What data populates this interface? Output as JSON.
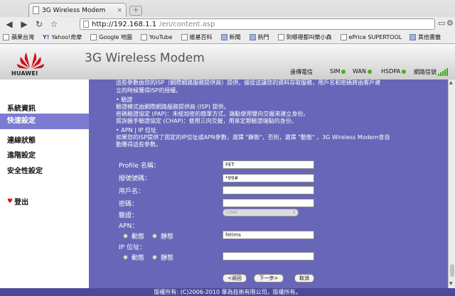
{
  "browser": {
    "tab_title": "3G Wireless Modem",
    "tab_close": "×",
    "new_tab": "+",
    "url_host": "http://192.168.1.1",
    "url_path": "/en/content.asp",
    "bookmarks": [
      {
        "label": "蘋果台灣",
        "kind": "page"
      },
      {
        "label": "Yahoo!奇摩",
        "kind": "yahoo"
      },
      {
        "label": "Google 地圖",
        "kind": "page"
      },
      {
        "label": "YouTube",
        "kind": "page"
      },
      {
        "label": "維基百科",
        "kind": "page"
      },
      {
        "label": "新聞",
        "kind": "folder"
      },
      {
        "label": "熱門",
        "kind": "folder"
      },
      {
        "label": "到哪裡都叫樂小森",
        "kind": "page"
      },
      {
        "label": "ePrice SUPERTOOL",
        "kind": "page"
      }
    ],
    "other_bookmarks": "其他書籤"
  },
  "header": {
    "brand": "HUAWEI",
    "app_name": "3G Wireless Modem",
    "carrier": "遠傳電信",
    "sim": "SIM",
    "wan": "WAN",
    "hsdpa": "HSDPA",
    "signal_label": "網路信號",
    "status_color": "#4caf1a"
  },
  "sidebar": {
    "items": [
      "系統資訊",
      "快速設定",
      "連線狀態",
      "進階設定",
      "安全性設定"
    ],
    "active_index": 1,
    "logout": "登出"
  },
  "content": {
    "top_line1": "這些參數由您的ISP（網際網路服務提供商）提供，據從這讓您的資料存取服務，用戶名和密碼將由客戶建",
    "top_line2": "立的時候獲得ISP的授權。",
    "auth_title": "• 驗證",
    "auth_line1": "驗證模式由網際網路服務提供商 (ISP) 提供。",
    "auth_line2": "密碼驗證協定 (PAP)：未經加密的簡單方式，端點使用雙向交握來建立身份。",
    "auth_line3": "質詢握手驗證協定 (CHAP)：使用三向交握，用來定期驗證端點的身份。",
    "apn_title": "• APN | IP 位址",
    "apn_line1": "如果您的ISP提供了固定的IP位址或APN參數，選擇 \"靜態\"，否則，選擇 \"動態\" ，3G Wireless Modem會自",
    "apn_line2": "動獲得這些參數。"
  },
  "form": {
    "profile_label": "Profile 名稱：",
    "profile_value": "FET",
    "dial_label": "撥號號碼：",
    "dial_value": "*99#",
    "user_label": "用戶名：",
    "user_value": "",
    "password_label": "密碼：",
    "password_value": "",
    "auth_label": "驗證：",
    "auth_value": "CHAP",
    "apn_label": "APN：",
    "apn_dynamic": "動態",
    "apn_static": "靜態",
    "apn_value": "fetims",
    "ip_label": "IP 位址：",
    "ip_dynamic": "動態",
    "ip_static": "靜態",
    "ip_value": ""
  },
  "buttons": {
    "back": "<返回",
    "next": "下一步>",
    "cancel": "取消"
  },
  "footer": "版權所有: (C)2006-2010 華為技術有限公司，版權所有。"
}
